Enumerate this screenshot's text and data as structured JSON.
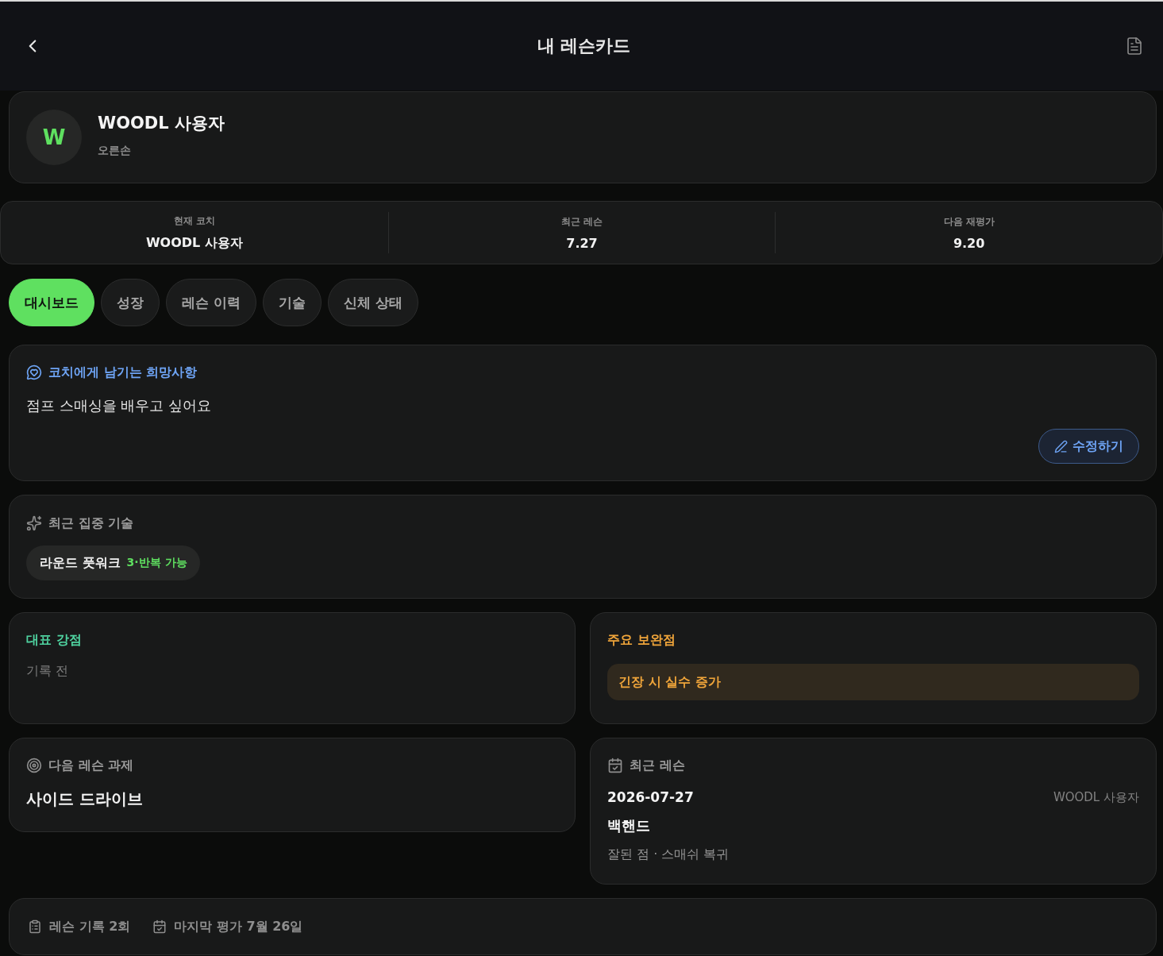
{
  "header": {
    "title": "내 레슨카드"
  },
  "profile": {
    "avatar_letter": "W",
    "name": "WOODL 사용자",
    "handedness": "오른손"
  },
  "stats": [
    {
      "label": "현재 코치",
      "value": "WOODL 사용자"
    },
    {
      "label": "최근 레슨",
      "value": "7.27"
    },
    {
      "label": "다음 재평가",
      "value": "9.20"
    }
  ],
  "tabs": [
    {
      "label": "대시보드",
      "selected": true
    },
    {
      "label": "성장",
      "selected": false
    },
    {
      "label": "레슨 이력",
      "selected": false
    },
    {
      "label": "기술",
      "selected": false
    },
    {
      "label": "신체 상태",
      "selected": false
    }
  ],
  "wish": {
    "title": "코치에게 남기는 희망사항",
    "text": "점프 스매싱을 배우고 싶어요",
    "edit_button": "수정하기"
  },
  "focus": {
    "title": "최근 집중 기술",
    "skills": [
      {
        "name": "라운드 풋워크",
        "status": "3·반복 가능"
      }
    ]
  },
  "strength": {
    "title": "대표 강점",
    "empty_text": "기록 전"
  },
  "weakness": {
    "title": "주요 보완점",
    "items": [
      "긴장 시 실수 증가"
    ]
  },
  "next_task": {
    "title": "다음 레슨 과제",
    "task": "사이드 드라이브"
  },
  "recent_lesson": {
    "title": "최근 레슨",
    "date": "2026-07-27",
    "coach": "WOODL 사용자",
    "skill": "백핸드",
    "note": "잘된 점 · 스매쉬 복귀"
  },
  "footer": {
    "items": [
      {
        "kind": "records",
        "text": "레슨 기록 2회"
      },
      {
        "kind": "evaluation",
        "text": "마지막 평가 7월 26일"
      }
    ]
  }
}
